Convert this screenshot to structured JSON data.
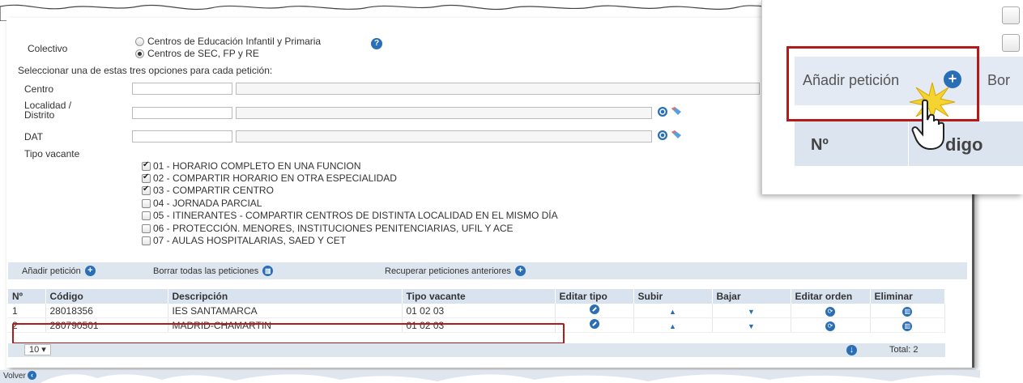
{
  "form": {
    "colectivo_label": "Colectivo",
    "colectivo_options": [
      {
        "label": "Centros de Educación Infantil y Primaria",
        "selected": false
      },
      {
        "label": "Centros de SEC, FP y RE",
        "selected": true
      }
    ],
    "select_instructions": "Seleccionar una de estas tres opciones para cada petición:",
    "centro_label": "Centro",
    "localidad_label_1": "Localidad /",
    "localidad_label_2": "Distrito",
    "dat_label": "DAT",
    "tipo_vacante_label": "Tipo vacante",
    "tipo_vacante_options": [
      {
        "label": "01 - HORARIO COMPLETO EN UNA FUNCION",
        "checked": true
      },
      {
        "label": "02 - COMPARTIR HORARIO EN OTRA ESPECIALIDAD",
        "checked": true
      },
      {
        "label": "03 - COMPARTIR CENTRO",
        "checked": true
      },
      {
        "label": "04 - JORNADA PARCIAL",
        "checked": false
      },
      {
        "label": "05 - ITINERANTES - COMPARTIR CENTROS DE DISTINTA LOCALIDAD EN EL MISMO DÍA",
        "checked": false
      },
      {
        "label": "06 - PROTECCIÓN. MENORES, INSTITUCIONES PENITENCIARIAS, UFIL Y ACE",
        "checked": false
      },
      {
        "label": "07 - AULAS HOSPITALARIAS, SAED Y CET",
        "checked": false
      }
    ]
  },
  "toolbar": {
    "add_label": "Añadir petición",
    "delete_all_label": "Borrar todas las peticiones",
    "recover_label": "Recuperar peticiones anteriores"
  },
  "table": {
    "headers": [
      "Nº",
      "Código",
      "Descripción",
      "Tipo vacante",
      "Editar tipo",
      "Subir",
      "Bajar",
      "Editar orden",
      "Eliminar"
    ],
    "rows": [
      {
        "n": "1",
        "codigo": "28018356",
        "descripcion": "IES SANTAMARCA",
        "tipo": "01 02 03"
      },
      {
        "n": "2",
        "codigo": "280790501",
        "descripcion": "MADRID-CHAMARTIN",
        "tipo": "01 02 03"
      }
    ]
  },
  "footer": {
    "page_size": "10",
    "total": "Total: 2"
  },
  "bottom": {
    "volver_label": "Volver"
  },
  "zoom": {
    "add_label": "Añadir petición",
    "bor_label": "Bor",
    "n_header": "Nº",
    "codigo_header": "digo"
  },
  "colors": {
    "accent": "#2a6fb6",
    "header_bg": "#d9e3ef",
    "highlight": "#b31b1b"
  }
}
